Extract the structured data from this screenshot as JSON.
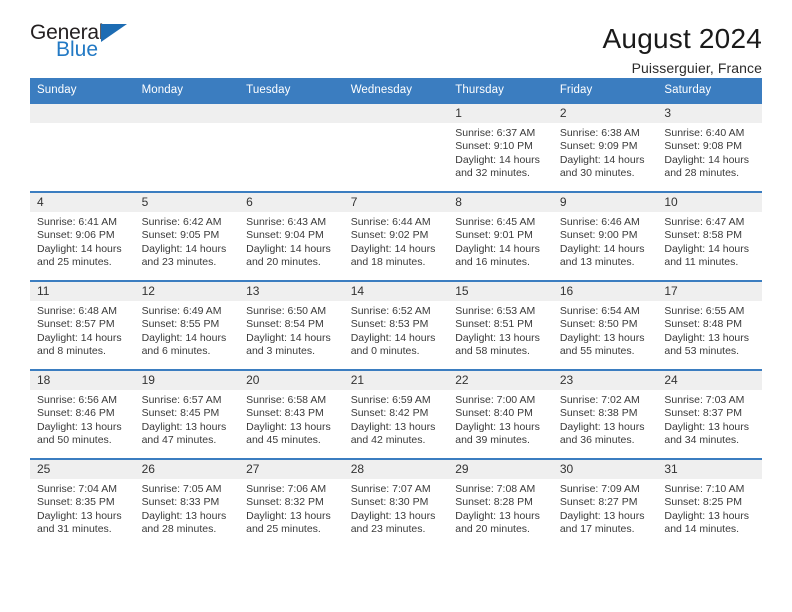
{
  "brand": {
    "name_part1": "General",
    "name_part2": "Blue",
    "triangle_color": "#1d6cb3",
    "blue_color": "#2279c4"
  },
  "header": {
    "title": "August 2024",
    "subtitle": "Puisserguier, France"
  },
  "theme": {
    "header_blue": "#3b7dc0",
    "daynum_band": "#efefef",
    "text": "#3a3a3a"
  },
  "weekday_headers": [
    "Sunday",
    "Monday",
    "Tuesday",
    "Wednesday",
    "Thursday",
    "Friday",
    "Saturday"
  ],
  "labels": {
    "sunrise": "Sunrise:",
    "sunset": "Sunset:",
    "daylight": "Daylight:"
  },
  "weeks": [
    [
      {
        "day": "",
        "empty": true
      },
      {
        "day": "",
        "empty": true
      },
      {
        "day": "",
        "empty": true
      },
      {
        "day": "",
        "empty": true
      },
      {
        "day": "1",
        "sunrise": "Sunrise: 6:37 AM",
        "sunset": "Sunset: 9:10 PM",
        "daylight_line1": "Daylight: 14 hours",
        "daylight_line2": "and 32 minutes."
      },
      {
        "day": "2",
        "sunrise": "Sunrise: 6:38 AM",
        "sunset": "Sunset: 9:09 PM",
        "daylight_line1": "Daylight: 14 hours",
        "daylight_line2": "and 30 minutes."
      },
      {
        "day": "3",
        "sunrise": "Sunrise: 6:40 AM",
        "sunset": "Sunset: 9:08 PM",
        "daylight_line1": "Daylight: 14 hours",
        "daylight_line2": "and 28 minutes."
      }
    ],
    [
      {
        "day": "4",
        "sunrise": "Sunrise: 6:41 AM",
        "sunset": "Sunset: 9:06 PM",
        "daylight_line1": "Daylight: 14 hours",
        "daylight_line2": "and 25 minutes."
      },
      {
        "day": "5",
        "sunrise": "Sunrise: 6:42 AM",
        "sunset": "Sunset: 9:05 PM",
        "daylight_line1": "Daylight: 14 hours",
        "daylight_line2": "and 23 minutes."
      },
      {
        "day": "6",
        "sunrise": "Sunrise: 6:43 AM",
        "sunset": "Sunset: 9:04 PM",
        "daylight_line1": "Daylight: 14 hours",
        "daylight_line2": "and 20 minutes."
      },
      {
        "day": "7",
        "sunrise": "Sunrise: 6:44 AM",
        "sunset": "Sunset: 9:02 PM",
        "daylight_line1": "Daylight: 14 hours",
        "daylight_line2": "and 18 minutes."
      },
      {
        "day": "8",
        "sunrise": "Sunrise: 6:45 AM",
        "sunset": "Sunset: 9:01 PM",
        "daylight_line1": "Daylight: 14 hours",
        "daylight_line2": "and 16 minutes."
      },
      {
        "day": "9",
        "sunrise": "Sunrise: 6:46 AM",
        "sunset": "Sunset: 9:00 PM",
        "daylight_line1": "Daylight: 14 hours",
        "daylight_line2": "and 13 minutes."
      },
      {
        "day": "10",
        "sunrise": "Sunrise: 6:47 AM",
        "sunset": "Sunset: 8:58 PM",
        "daylight_line1": "Daylight: 14 hours",
        "daylight_line2": "and 11 minutes."
      }
    ],
    [
      {
        "day": "11",
        "sunrise": "Sunrise: 6:48 AM",
        "sunset": "Sunset: 8:57 PM",
        "daylight_line1": "Daylight: 14 hours",
        "daylight_line2": "and 8 minutes."
      },
      {
        "day": "12",
        "sunrise": "Sunrise: 6:49 AM",
        "sunset": "Sunset: 8:55 PM",
        "daylight_line1": "Daylight: 14 hours",
        "daylight_line2": "and 6 minutes."
      },
      {
        "day": "13",
        "sunrise": "Sunrise: 6:50 AM",
        "sunset": "Sunset: 8:54 PM",
        "daylight_line1": "Daylight: 14 hours",
        "daylight_line2": "and 3 minutes."
      },
      {
        "day": "14",
        "sunrise": "Sunrise: 6:52 AM",
        "sunset": "Sunset: 8:53 PM",
        "daylight_line1": "Daylight: 14 hours",
        "daylight_line2": "and 0 minutes."
      },
      {
        "day": "15",
        "sunrise": "Sunrise: 6:53 AM",
        "sunset": "Sunset: 8:51 PM",
        "daylight_line1": "Daylight: 13 hours",
        "daylight_line2": "and 58 minutes."
      },
      {
        "day": "16",
        "sunrise": "Sunrise: 6:54 AM",
        "sunset": "Sunset: 8:50 PM",
        "daylight_line1": "Daylight: 13 hours",
        "daylight_line2": "and 55 minutes."
      },
      {
        "day": "17",
        "sunrise": "Sunrise: 6:55 AM",
        "sunset": "Sunset: 8:48 PM",
        "daylight_line1": "Daylight: 13 hours",
        "daylight_line2": "and 53 minutes."
      }
    ],
    [
      {
        "day": "18",
        "sunrise": "Sunrise: 6:56 AM",
        "sunset": "Sunset: 8:46 PM",
        "daylight_line1": "Daylight: 13 hours",
        "daylight_line2": "and 50 minutes."
      },
      {
        "day": "19",
        "sunrise": "Sunrise: 6:57 AM",
        "sunset": "Sunset: 8:45 PM",
        "daylight_line1": "Daylight: 13 hours",
        "daylight_line2": "and 47 minutes."
      },
      {
        "day": "20",
        "sunrise": "Sunrise: 6:58 AM",
        "sunset": "Sunset: 8:43 PM",
        "daylight_line1": "Daylight: 13 hours",
        "daylight_line2": "and 45 minutes."
      },
      {
        "day": "21",
        "sunrise": "Sunrise: 6:59 AM",
        "sunset": "Sunset: 8:42 PM",
        "daylight_line1": "Daylight: 13 hours",
        "daylight_line2": "and 42 minutes."
      },
      {
        "day": "22",
        "sunrise": "Sunrise: 7:00 AM",
        "sunset": "Sunset: 8:40 PM",
        "daylight_line1": "Daylight: 13 hours",
        "daylight_line2": "and 39 minutes."
      },
      {
        "day": "23",
        "sunrise": "Sunrise: 7:02 AM",
        "sunset": "Sunset: 8:38 PM",
        "daylight_line1": "Daylight: 13 hours",
        "daylight_line2": "and 36 minutes."
      },
      {
        "day": "24",
        "sunrise": "Sunrise: 7:03 AM",
        "sunset": "Sunset: 8:37 PM",
        "daylight_line1": "Daylight: 13 hours",
        "daylight_line2": "and 34 minutes."
      }
    ],
    [
      {
        "day": "25",
        "sunrise": "Sunrise: 7:04 AM",
        "sunset": "Sunset: 8:35 PM",
        "daylight_line1": "Daylight: 13 hours",
        "daylight_line2": "and 31 minutes."
      },
      {
        "day": "26",
        "sunrise": "Sunrise: 7:05 AM",
        "sunset": "Sunset: 8:33 PM",
        "daylight_line1": "Daylight: 13 hours",
        "daylight_line2": "and 28 minutes."
      },
      {
        "day": "27",
        "sunrise": "Sunrise: 7:06 AM",
        "sunset": "Sunset: 8:32 PM",
        "daylight_line1": "Daylight: 13 hours",
        "daylight_line2": "and 25 minutes."
      },
      {
        "day": "28",
        "sunrise": "Sunrise: 7:07 AM",
        "sunset": "Sunset: 8:30 PM",
        "daylight_line1": "Daylight: 13 hours",
        "daylight_line2": "and 23 minutes."
      },
      {
        "day": "29",
        "sunrise": "Sunrise: 7:08 AM",
        "sunset": "Sunset: 8:28 PM",
        "daylight_line1": "Daylight: 13 hours",
        "daylight_line2": "and 20 minutes."
      },
      {
        "day": "30",
        "sunrise": "Sunrise: 7:09 AM",
        "sunset": "Sunset: 8:27 PM",
        "daylight_line1": "Daylight: 13 hours",
        "daylight_line2": "and 17 minutes."
      },
      {
        "day": "31",
        "sunrise": "Sunrise: 7:10 AM",
        "sunset": "Sunset: 8:25 PM",
        "daylight_line1": "Daylight: 13 hours",
        "daylight_line2": "and 14 minutes."
      }
    ]
  ]
}
